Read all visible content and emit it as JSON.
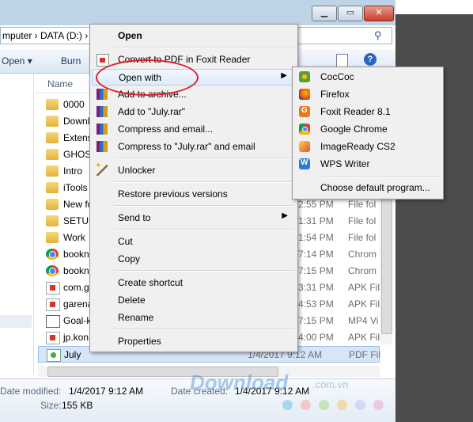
{
  "address": {
    "path": "mputer › DATA (D:) ›"
  },
  "toolbar": {
    "open_label": "Open ▾",
    "burn_label": "Burn"
  },
  "columns": {
    "name": "Name"
  },
  "files": [
    {
      "name": "0000",
      "date": "",
      "type": "",
      "icon": "folder-icon"
    },
    {
      "name": "Downl",
      "date": "",
      "type": "",
      "icon": "folder-icon"
    },
    {
      "name": "Extens",
      "date": "",
      "type": "",
      "icon": "folder-icon"
    },
    {
      "name": "GHOS",
      "date": "",
      "type": "",
      "icon": "folder-icon"
    },
    {
      "name": "Intro",
      "date": "",
      "type": "",
      "icon": "folder-icon"
    },
    {
      "name": "iTools",
      "date": "",
      "type": "",
      "icon": "folder-icon"
    },
    {
      "name": "New fo",
      "date": "2:55 PM",
      "type": "File fol",
      "icon": "folder-icon"
    },
    {
      "name": "SETUP",
      "date": "1:31 PM",
      "type": "File fol",
      "icon": "folder-icon"
    },
    {
      "name": "Work",
      "date": "1:54 PM",
      "type": "File fol",
      "icon": "folder-icon"
    },
    {
      "name": "bookn",
      "date": "7:14 PM",
      "type": "Chrom",
      "icon": "chrome-icon"
    },
    {
      "name": "bookn",
      "date": "7:15 PM",
      "type": "Chrom",
      "icon": "chrome-icon"
    },
    {
      "name": "com.g",
      "date": "3:31 PM",
      "type": "APK Fil",
      "icon": "apk-icon"
    },
    {
      "name": "garena",
      "date": "4:53 PM",
      "type": "APK Fil",
      "icon": "apk-icon"
    },
    {
      "name": "Goal-k",
      "date": "7:15 PM",
      "type": "MP4 Vi",
      "icon": "mp4-icon"
    },
    {
      "name": "jp.kon",
      "date": "4:00 PM",
      "type": "APK Fil",
      "icon": "apk-icon"
    },
    {
      "name": "July",
      "date": "1/4/2017 9:12 AM",
      "type": "PDF Fil",
      "icon": "pdf-icon",
      "selected": true
    }
  ],
  "details": {
    "modified_label": "Date modified:",
    "modified_value": "1/4/2017 9:12 AM",
    "created_label": "Date created:",
    "created_value": "1/4/2017 9:12 AM",
    "size_label": "Size:",
    "size_value": "155 KB"
  },
  "context_menu": {
    "open": "Open",
    "convert_pdf": "Convert to PDF in Foxit Reader",
    "open_with": "Open with",
    "add_archive": "Add to archive...",
    "add_rar": "Add to \"July.rar\"",
    "compress_email": "Compress and email...",
    "compress_rar_email": "Compress to \"July.rar\" and email",
    "unlocker": "Unlocker",
    "restore": "Restore previous versions",
    "send_to": "Send to",
    "cut": "Cut",
    "copy": "Copy",
    "create_shortcut": "Create shortcut",
    "delete": "Delete",
    "rename": "Rename",
    "properties": "Properties"
  },
  "open_with_submenu": {
    "items": [
      "CocCoc",
      "Firefox",
      "Foxit Reader 8.1",
      "Google Chrome",
      "ImageReady CS2",
      "WPS Writer"
    ],
    "choose_default": "Choose default program..."
  },
  "watermark": {
    "brand": "Download",
    "suffix": ".com.vn"
  },
  "colors": {
    "highlight_circle": "#e0202b",
    "selection": "#d6e6f7",
    "accent": "#2b5797"
  }
}
